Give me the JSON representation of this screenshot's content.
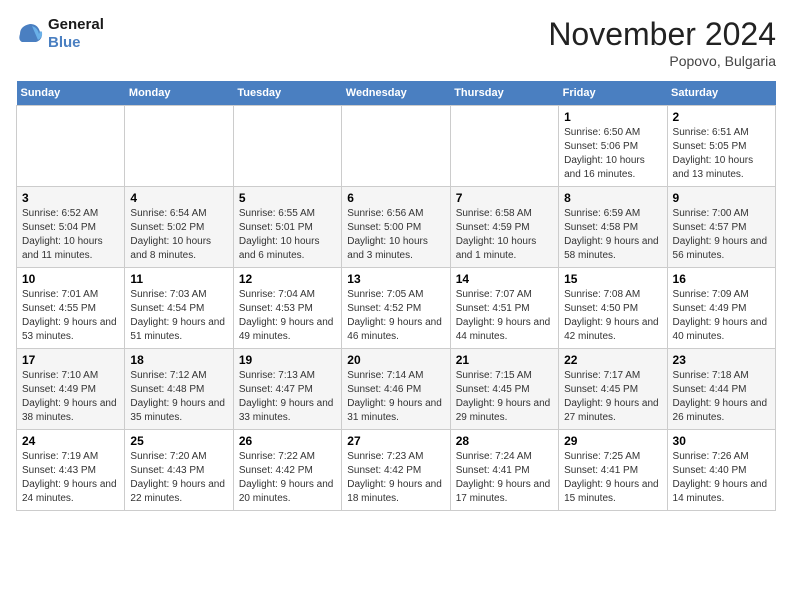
{
  "logo": {
    "line1": "General",
    "line2": "Blue"
  },
  "title": "November 2024",
  "location": "Popovo, Bulgaria",
  "weekdays": [
    "Sunday",
    "Monday",
    "Tuesday",
    "Wednesday",
    "Thursday",
    "Friday",
    "Saturday"
  ],
  "weeks": [
    [
      {
        "day": "",
        "info": ""
      },
      {
        "day": "",
        "info": ""
      },
      {
        "day": "",
        "info": ""
      },
      {
        "day": "",
        "info": ""
      },
      {
        "day": "",
        "info": ""
      },
      {
        "day": "1",
        "info": "Sunrise: 6:50 AM\nSunset: 5:06 PM\nDaylight: 10 hours and 16 minutes."
      },
      {
        "day": "2",
        "info": "Sunrise: 6:51 AM\nSunset: 5:05 PM\nDaylight: 10 hours and 13 minutes."
      }
    ],
    [
      {
        "day": "3",
        "info": "Sunrise: 6:52 AM\nSunset: 5:04 PM\nDaylight: 10 hours and 11 minutes."
      },
      {
        "day": "4",
        "info": "Sunrise: 6:54 AM\nSunset: 5:02 PM\nDaylight: 10 hours and 8 minutes."
      },
      {
        "day": "5",
        "info": "Sunrise: 6:55 AM\nSunset: 5:01 PM\nDaylight: 10 hours and 6 minutes."
      },
      {
        "day": "6",
        "info": "Sunrise: 6:56 AM\nSunset: 5:00 PM\nDaylight: 10 hours and 3 minutes."
      },
      {
        "day": "7",
        "info": "Sunrise: 6:58 AM\nSunset: 4:59 PM\nDaylight: 10 hours and 1 minute."
      },
      {
        "day": "8",
        "info": "Sunrise: 6:59 AM\nSunset: 4:58 PM\nDaylight: 9 hours and 58 minutes."
      },
      {
        "day": "9",
        "info": "Sunrise: 7:00 AM\nSunset: 4:57 PM\nDaylight: 9 hours and 56 minutes."
      }
    ],
    [
      {
        "day": "10",
        "info": "Sunrise: 7:01 AM\nSunset: 4:55 PM\nDaylight: 9 hours and 53 minutes."
      },
      {
        "day": "11",
        "info": "Sunrise: 7:03 AM\nSunset: 4:54 PM\nDaylight: 9 hours and 51 minutes."
      },
      {
        "day": "12",
        "info": "Sunrise: 7:04 AM\nSunset: 4:53 PM\nDaylight: 9 hours and 49 minutes."
      },
      {
        "day": "13",
        "info": "Sunrise: 7:05 AM\nSunset: 4:52 PM\nDaylight: 9 hours and 46 minutes."
      },
      {
        "day": "14",
        "info": "Sunrise: 7:07 AM\nSunset: 4:51 PM\nDaylight: 9 hours and 44 minutes."
      },
      {
        "day": "15",
        "info": "Sunrise: 7:08 AM\nSunset: 4:50 PM\nDaylight: 9 hours and 42 minutes."
      },
      {
        "day": "16",
        "info": "Sunrise: 7:09 AM\nSunset: 4:49 PM\nDaylight: 9 hours and 40 minutes."
      }
    ],
    [
      {
        "day": "17",
        "info": "Sunrise: 7:10 AM\nSunset: 4:49 PM\nDaylight: 9 hours and 38 minutes."
      },
      {
        "day": "18",
        "info": "Sunrise: 7:12 AM\nSunset: 4:48 PM\nDaylight: 9 hours and 35 minutes."
      },
      {
        "day": "19",
        "info": "Sunrise: 7:13 AM\nSunset: 4:47 PM\nDaylight: 9 hours and 33 minutes."
      },
      {
        "day": "20",
        "info": "Sunrise: 7:14 AM\nSunset: 4:46 PM\nDaylight: 9 hours and 31 minutes."
      },
      {
        "day": "21",
        "info": "Sunrise: 7:15 AM\nSunset: 4:45 PM\nDaylight: 9 hours and 29 minutes."
      },
      {
        "day": "22",
        "info": "Sunrise: 7:17 AM\nSunset: 4:45 PM\nDaylight: 9 hours and 27 minutes."
      },
      {
        "day": "23",
        "info": "Sunrise: 7:18 AM\nSunset: 4:44 PM\nDaylight: 9 hours and 26 minutes."
      }
    ],
    [
      {
        "day": "24",
        "info": "Sunrise: 7:19 AM\nSunset: 4:43 PM\nDaylight: 9 hours and 24 minutes."
      },
      {
        "day": "25",
        "info": "Sunrise: 7:20 AM\nSunset: 4:43 PM\nDaylight: 9 hours and 22 minutes."
      },
      {
        "day": "26",
        "info": "Sunrise: 7:22 AM\nSunset: 4:42 PM\nDaylight: 9 hours and 20 minutes."
      },
      {
        "day": "27",
        "info": "Sunrise: 7:23 AM\nSunset: 4:42 PM\nDaylight: 9 hours and 18 minutes."
      },
      {
        "day": "28",
        "info": "Sunrise: 7:24 AM\nSunset: 4:41 PM\nDaylight: 9 hours and 17 minutes."
      },
      {
        "day": "29",
        "info": "Sunrise: 7:25 AM\nSunset: 4:41 PM\nDaylight: 9 hours and 15 minutes."
      },
      {
        "day": "30",
        "info": "Sunrise: 7:26 AM\nSunset: 4:40 PM\nDaylight: 9 hours and 14 minutes."
      }
    ]
  ]
}
